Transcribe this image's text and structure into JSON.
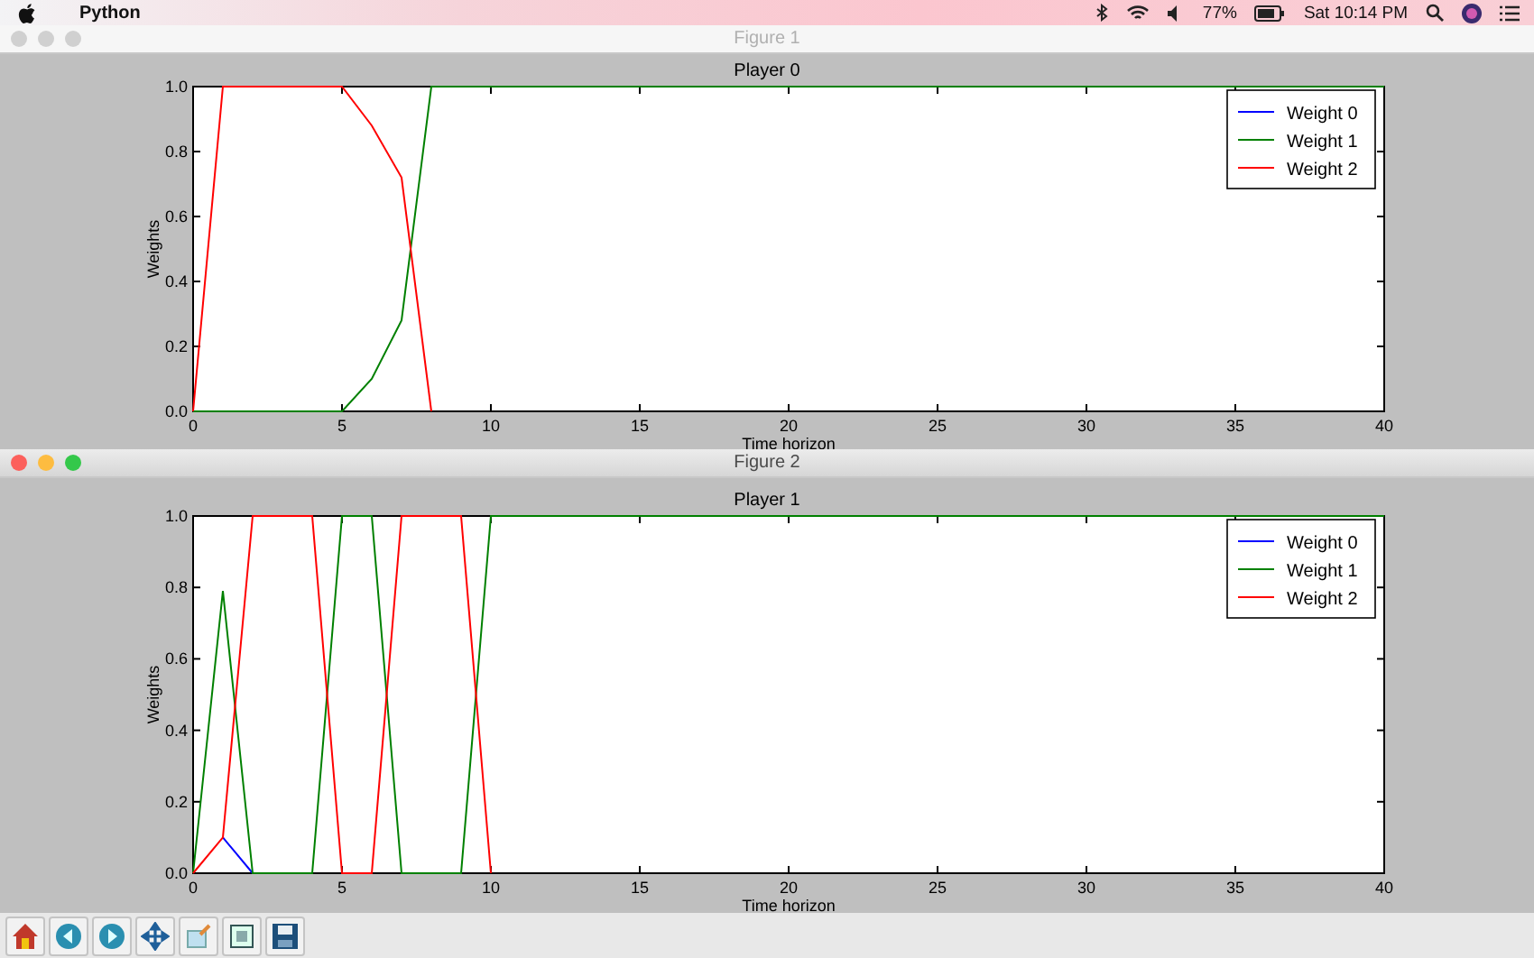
{
  "menu_bar": {
    "app_name": "Python",
    "battery": "77%",
    "clock": "Sat 10:14 PM"
  },
  "figures": [
    {
      "window_title": "Figure 1",
      "focused": false,
      "chart_data": {
        "type": "line",
        "title": "Player 0",
        "xlabel": "Time horizon",
        "ylabel": "Weights",
        "x": [
          0,
          1,
          2,
          3,
          4,
          5,
          6,
          7,
          8,
          9,
          10,
          11,
          12,
          13,
          14,
          15,
          16,
          17,
          18,
          19,
          20,
          21,
          22,
          23,
          24,
          25,
          26,
          27,
          28,
          29,
          30,
          31,
          32,
          33,
          34,
          35,
          36,
          37,
          38,
          39,
          40
        ],
        "series": [
          {
            "name": "Weight 0",
            "color": "#0000ff",
            "values": [
              null,
              null,
              null,
              null,
              null,
              null,
              null,
              null,
              null,
              null,
              null,
              null,
              null,
              null,
              null,
              null,
              null,
              null,
              null,
              null,
              null,
              null,
              null,
              null,
              null,
              null,
              null,
              null,
              null,
              null,
              null,
              null,
              null,
              null,
              null,
              null,
              null,
              null,
              null,
              null,
              null
            ]
          },
          {
            "name": "Weight 1",
            "color": "#008000",
            "values": [
              0,
              0,
              0,
              0,
              0,
              0,
              0.1,
              0.28,
              1,
              1,
              1,
              1,
              1,
              1,
              1,
              1,
              1,
              1,
              1,
              1,
              1,
              1,
              1,
              1,
              1,
              1,
              1,
              1,
              1,
              1,
              1,
              1,
              1,
              1,
              1,
              1,
              1,
              1,
              1,
              1,
              1
            ]
          },
          {
            "name": "Weight 2",
            "color": "#ff0000",
            "values": [
              0,
              1,
              1,
              1,
              1,
              1,
              0.88,
              0.72,
              0,
              null,
              null,
              null,
              null,
              null,
              null,
              null,
              null,
              null,
              null,
              null,
              null,
              null,
              null,
              null,
              null,
              null,
              null,
              null,
              null,
              null,
              null,
              null,
              null,
              null,
              null,
              null,
              null,
              null,
              null,
              null,
              null
            ]
          }
        ],
        "xlim": [
          0,
          40
        ],
        "ylim": [
          0,
          1
        ],
        "xticks": [
          0,
          5,
          10,
          15,
          20,
          25,
          30,
          35,
          40
        ],
        "legend": true,
        "yticks": [
          {
            "value": 0,
            "label": "0.0"
          },
          {
            "value": 0.2,
            "label": "0.2"
          },
          {
            "value": 0.4,
            "label": "0.4"
          },
          {
            "value": 0.6,
            "label": "0.6"
          },
          {
            "value": 0.8,
            "label": "0.8"
          },
          {
            "value": 1,
            "label": "1.0"
          }
        ]
      }
    },
    {
      "window_title": "Figure 2",
      "focused": true,
      "chart_data": {
        "type": "line",
        "title": "Player 1",
        "xlabel": "Time horizon",
        "ylabel": "Weights",
        "x": [
          0,
          1,
          2,
          3,
          4,
          5,
          6,
          7,
          8,
          9,
          10,
          11,
          12,
          13,
          14,
          15,
          16,
          17,
          18,
          19,
          20,
          21,
          22,
          23,
          24,
          25,
          26,
          27,
          28,
          29,
          30,
          31,
          32,
          33,
          34,
          35,
          36,
          37,
          38,
          39,
          40
        ],
        "series": [
          {
            "name": "Weight 0",
            "color": "#0000ff",
            "values": [
              null,
              0.1,
              0,
              null,
              null,
              null,
              null,
              null,
              null,
              null,
              null,
              null,
              null,
              null,
              null,
              null,
              null,
              null,
              null,
              null,
              null,
              null,
              null,
              null,
              null,
              null,
              null,
              null,
              null,
              null,
              null,
              null,
              null,
              null,
              null,
              null,
              null,
              null,
              null,
              null,
              null
            ]
          },
          {
            "name": "Weight 1",
            "color": "#008000",
            "values": [
              0,
              0.79,
              0,
              0,
              0,
              1,
              1,
              0,
              0,
              0,
              1,
              1,
              1,
              1,
              1,
              1,
              1,
              1,
              1,
              1,
              1,
              1,
              1,
              1,
              1,
              1,
              1,
              1,
              1,
              1,
              1,
              1,
              1,
              1,
              1,
              1,
              1,
              1,
              1,
              1,
              1
            ]
          },
          {
            "name": "Weight 2",
            "color": "#ff0000",
            "values": [
              0,
              0.1,
              1,
              1,
              1,
              0,
              0,
              1,
              1,
              1,
              0,
              null,
              null,
              null,
              null,
              null,
              null,
              null,
              null,
              null,
              null,
              null,
              null,
              null,
              null,
              null,
              null,
              null,
              null,
              null,
              null,
              null,
              null,
              null,
              null,
              null,
              null,
              null,
              null,
              null,
              null
            ]
          }
        ],
        "xlim": [
          0,
          40
        ],
        "ylim": [
          0,
          1
        ],
        "xticks": [
          0,
          5,
          10,
          15,
          20,
          25,
          30,
          35,
          40
        ],
        "legend": true,
        "yticks": [
          {
            "value": 0,
            "label": "0.0"
          },
          {
            "value": 0.2,
            "label": "0.2"
          },
          {
            "value": 0.4,
            "label": "0.4"
          },
          {
            "value": 0.6,
            "label": "0.6"
          },
          {
            "value": 0.8,
            "label": "0.8"
          },
          {
            "value": 1,
            "label": "1.0"
          }
        ]
      }
    }
  ]
}
